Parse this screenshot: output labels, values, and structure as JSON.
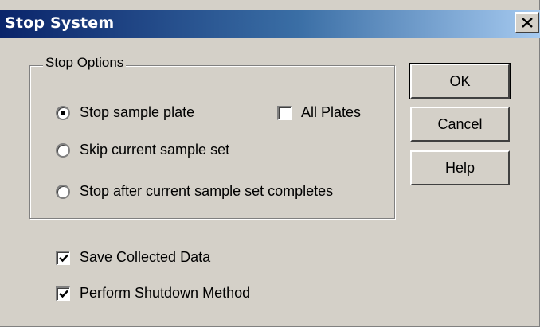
{
  "window": {
    "title": "Stop System",
    "close_glyph": "X"
  },
  "stop_options": {
    "legend": "Stop Options",
    "radios": [
      {
        "label": "Stop sample plate",
        "selected": true
      },
      {
        "label": "Skip current sample set",
        "selected": false
      },
      {
        "label": "Stop after current sample set completes",
        "selected": false
      }
    ],
    "all_plates": {
      "label": "All Plates",
      "checked": false
    }
  },
  "checkboxes": [
    {
      "label": "Save Collected Data",
      "checked": true
    },
    {
      "label": "Perform Shutdown Method",
      "checked": true
    }
  ],
  "buttons": {
    "ok": "OK",
    "cancel": "Cancel",
    "help": "Help"
  },
  "icons": {
    "close": "close-icon",
    "check": "check-icon",
    "radio_dot": "radio-dot-icon"
  },
  "colors": {
    "face": "#d4d0c8",
    "title_start": "#0a246a",
    "title_end": "#a6caf0"
  }
}
